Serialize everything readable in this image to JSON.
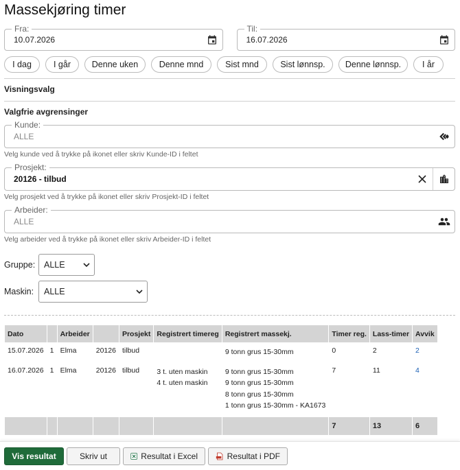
{
  "title": "Massekjøring timer",
  "dates": {
    "from_label": "Fra:",
    "from_value": "10.07.2026",
    "to_label": "Til:",
    "to_value": "16.07.2026"
  },
  "quick_ranges": [
    "I dag",
    "I går",
    "Denne uken",
    "Denne mnd",
    "Sist mnd",
    "Sist lønnsp.",
    "Denne lønnsp.",
    "I år"
  ],
  "sections": {
    "view_options": "Visningsvalg",
    "optional_filters": "Valgfrie avgrensinger"
  },
  "filters": {
    "customer": {
      "label": "Kunde:",
      "value": "ALLE",
      "helper": "Velg kunde ved å trykke på ikonet eller skriv Kunde-ID i feltet"
    },
    "project": {
      "label": "Prosjekt:",
      "value": "20126 - tilbud",
      "helper": "Velg prosjekt ved å trykke på ikonet eller skriv Prosjekt-ID i feltet"
    },
    "worker": {
      "label": "Arbeider:",
      "value": "ALLE",
      "helper": "Velg arbeider ved å trykke på ikonet eller skriv Arbeider-ID i feltet"
    }
  },
  "selects": {
    "group": {
      "label": "Gruppe:",
      "value": "ALLE"
    },
    "machine": {
      "label": "Maskin:",
      "value": "ALLE"
    }
  },
  "table": {
    "headers": [
      "Dato",
      "",
      "Arbeider",
      "",
      "Prosjekt",
      "Registrert timereg",
      "Registrert massekj.",
      "Timer reg.",
      "Lass-timer",
      "Avvik"
    ],
    "rows": [
      {
        "date": "15.07.2026",
        "num": "1",
        "worker": "Elma",
        "project_id": "20126",
        "project": "tilbud",
        "timereg": [],
        "massekj": [
          "9 tonn grus 15-30mm"
        ],
        "hours": "0",
        "load_hours": "2",
        "deviation": "2"
      },
      {
        "date": "16.07.2026",
        "num": "1",
        "worker": "Elma",
        "project_id": "20126",
        "project": "tilbud",
        "timereg": [
          "3 t. uten maskin",
          "4 t. uten maskin"
        ],
        "massekj": [
          "9 tonn grus 15-30mm",
          "9 tonn grus 15-30mm",
          "8 tonn grus 15-30mm",
          "1 tonn grus 15-30mm - KA1673"
        ],
        "hours": "7",
        "load_hours": "11",
        "deviation": "4"
      }
    ],
    "totals": {
      "hours": "7",
      "load_hours": "13",
      "deviation": "6"
    }
  },
  "buttons": {
    "show": "Vis resultat",
    "print": "Skriv ut",
    "excel": "Resultat i Excel",
    "pdf": "Resultat i PDF"
  },
  "colors": {
    "primary": "#1f6b3a",
    "link": "#1a5fb4",
    "header_bg": "#d4d4d4"
  }
}
